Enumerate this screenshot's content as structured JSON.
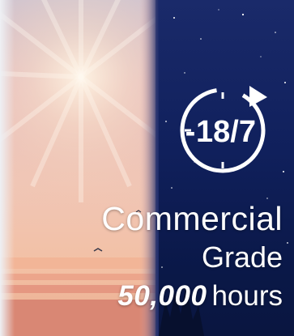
{
  "badge": {
    "schedule": "18/7",
    "line1": "Commercial",
    "line2": "Grade",
    "hours_value": "50,000",
    "hours_unit": "hours"
  },
  "icons": {
    "clock": "clock-cycle-icon"
  },
  "colors": {
    "night_sky": "#0d1f5a",
    "sunset_peach": "#e9b9b0",
    "text": "#ffffff"
  }
}
